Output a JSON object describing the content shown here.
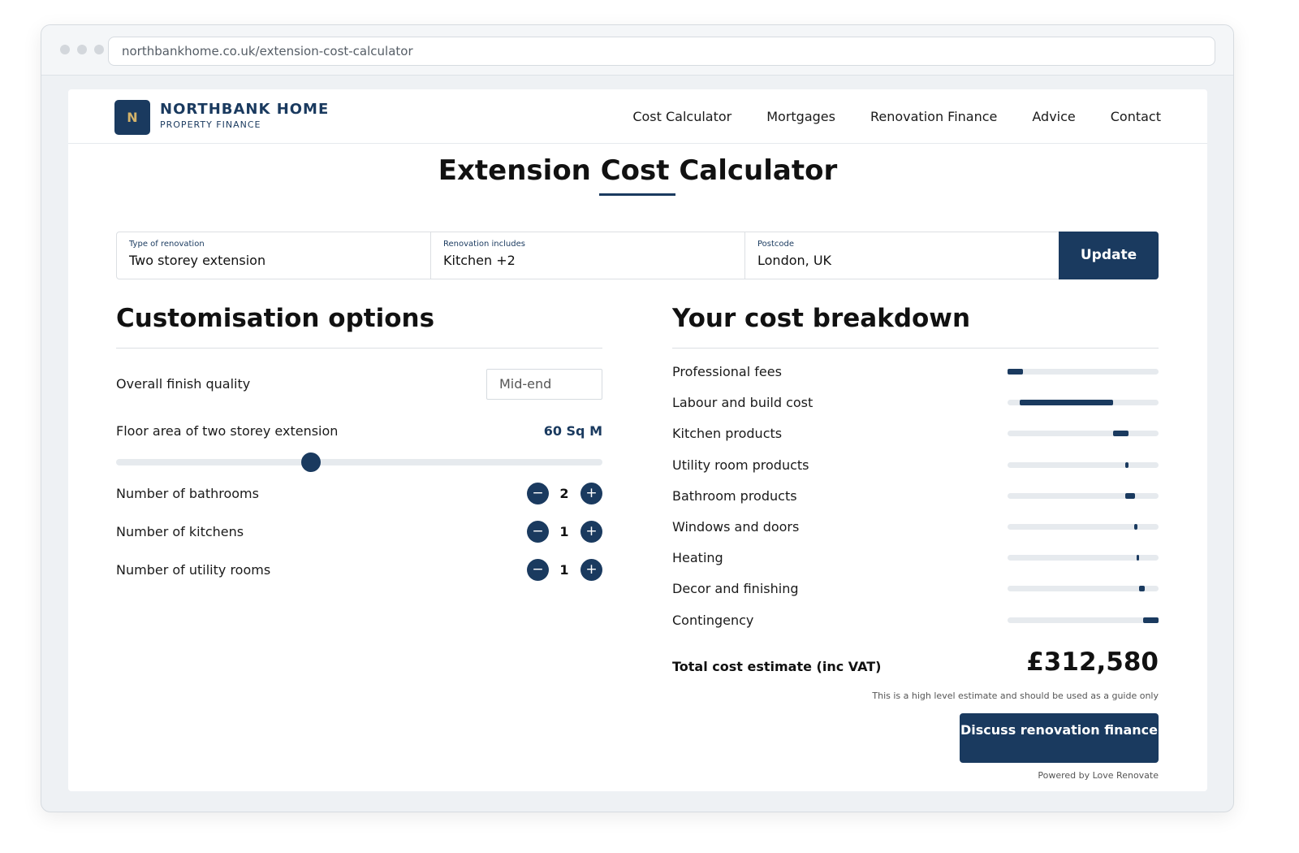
{
  "browser": {
    "url": "northbankhome.co.uk/extension-cost-calculator"
  },
  "brand": {
    "logo_letter": "N",
    "name": "NORTHBANK HOME",
    "tagline": "PROPERTY FINANCE"
  },
  "nav": {
    "items": [
      "Cost Calculator",
      "Mortgages",
      "Renovation Finance",
      "Advice",
      "Contact"
    ]
  },
  "page_title": "Extension Cost Calculator",
  "filters": {
    "type": {
      "label": "Type of renovation",
      "value": "Two storey extension"
    },
    "includes": {
      "label": "Renovation includes",
      "value": "Kitchen +2"
    },
    "postcode": {
      "label": "Postcode",
      "value": "London, UK"
    },
    "update_label": "Update"
  },
  "customisation": {
    "title": "Customisation options",
    "finish": {
      "label": "Overall finish quality",
      "value": "Mid-end"
    },
    "area": {
      "label": "Floor area of two storey extension",
      "value": "60 Sq M",
      "slider_fraction": 0.4
    },
    "bathrooms": {
      "label": "Number of bathrooms",
      "value": "2"
    },
    "kitchens": {
      "label": "Number of kitchens",
      "value": "1"
    },
    "utility": {
      "label": "Number of utility rooms",
      "value": "1"
    },
    "minus_symbol": "−",
    "plus_symbol": "+"
  },
  "breakdown": {
    "title": "Your cost breakdown",
    "items": [
      {
        "label": "Professional fees",
        "start": 0.0,
        "share": 0.1
      },
      {
        "label": "Labour and build cost",
        "start": 0.08,
        "share": 0.62
      },
      {
        "label": "Kitchen products",
        "start": 0.7,
        "share": 0.1
      },
      {
        "label": "Utility room products",
        "start": 0.78,
        "share": 0.02
      },
      {
        "label": "Bathroom products",
        "start": 0.78,
        "share": 0.065
      },
      {
        "label": "Windows and doors",
        "start": 0.84,
        "share": 0.02
      },
      {
        "label": "Heating",
        "start": 0.855,
        "share": 0.015
      },
      {
        "label": "Decor and finishing",
        "start": 0.87,
        "share": 0.04
      },
      {
        "label": "Contingency",
        "start": 0.9,
        "share": 0.1
      }
    ],
    "total_label": "Total cost estimate (inc VAT)",
    "total_value": "£312,580",
    "disclaimer": "This is a high level estimate and should be used as a guide only",
    "cta_label": "Discuss renovation finance",
    "powered_by": "Powered by Love Renovate"
  },
  "colors": {
    "primary": "#1a3a5f",
    "accent": "#d4b36a",
    "track": "#e6eaee"
  }
}
